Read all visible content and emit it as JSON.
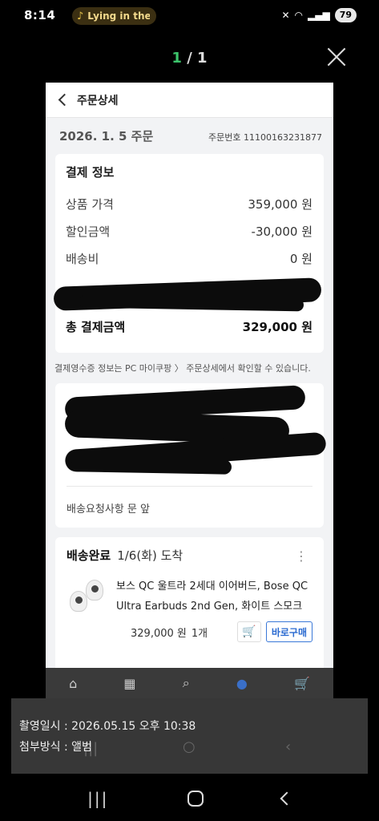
{
  "status_bar": {
    "time": "8:14",
    "media_text": "Lying in the",
    "battery": "79"
  },
  "viewer": {
    "current": "1",
    "total": "/ 1"
  },
  "order_page": {
    "title": "주문상세",
    "order_date": "2026. 1. 5 주문",
    "order_number": "주문번호 11100163231877",
    "payment": {
      "title": "결제 정보",
      "rows": [
        {
          "label": "상품 가격",
          "value": "359,000 원"
        },
        {
          "label": "할인금액",
          "value": "-30,000 원"
        },
        {
          "label": "배송비",
          "value": "0 원"
        }
      ],
      "total_label": "총 결제금액",
      "total_value": "329,000 원"
    },
    "receipt_note": "결제영수증 정보는 PC 마이쿠팡 〉 주문상세에서 확인할 수 있습니다.",
    "delivery_request_label": "배송요청사항",
    "delivery_request_value": "문 앞",
    "delivery": {
      "status": "배송완료",
      "date": "1/6(화) 도착",
      "product_name": "보스 QC 울트라 2세대 이어버드, Bose QC Ultra Earbuds 2nd Gen, 화이트 스모크",
      "price": "329,000 원",
      "quantity": "1개",
      "buy_label": "바로구매"
    }
  },
  "info": {
    "captured_at": "촬영일시 : 2026.05.15 오후 10:38",
    "attach_method": "첨부방식 : 앨범"
  }
}
